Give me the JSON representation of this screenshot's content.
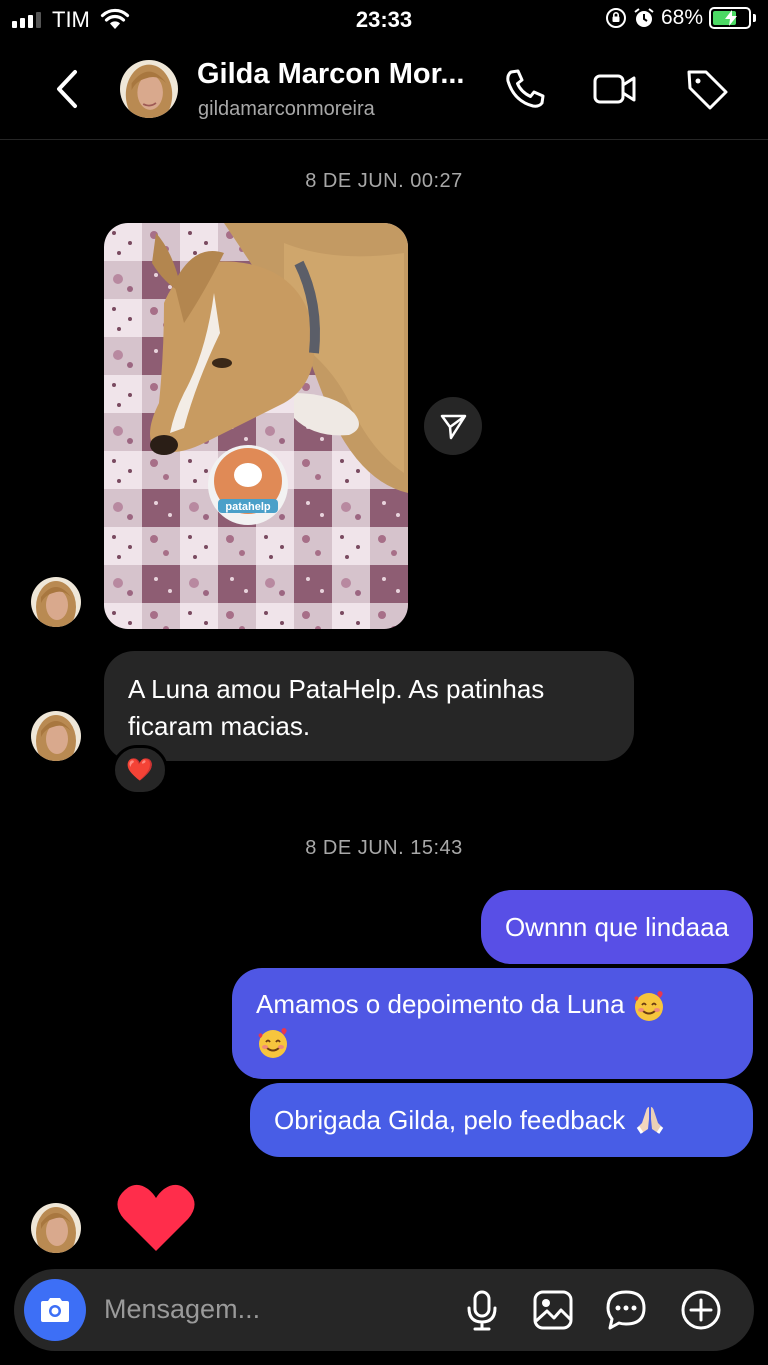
{
  "status_bar": {
    "carrier": "TIM",
    "time": "23:33",
    "battery": "68%",
    "battery_level": 0.68
  },
  "header": {
    "name": "Gilda Marcon Mor...",
    "handle": "gildamarconmoreira"
  },
  "messages": {
    "timestamp1": "8 DE JUN. 00:27",
    "incoming_text_line1": "A Luna amou PataHelp. As patinhas",
    "incoming_text_line2": "ficaram macias.",
    "reaction": "❤️",
    "timestamp2": "8 DE JUN. 15:43",
    "outgoing": [
      {
        "text": "Ownnn que lindaaa"
      },
      {
        "text": "Amamos o depoimento da Luna"
      },
      {
        "text": "Obrigada Gilda, pelo feedback"
      }
    ]
  },
  "photo": {
    "label": "patahelp"
  },
  "composer": {
    "placeholder": "Mensagem..."
  },
  "colors": {
    "outgoing_bubble": "#584fe6",
    "incoming_bubble": "#262626",
    "camera_button": "#3d6ff6",
    "heart": "#ff2d55"
  }
}
